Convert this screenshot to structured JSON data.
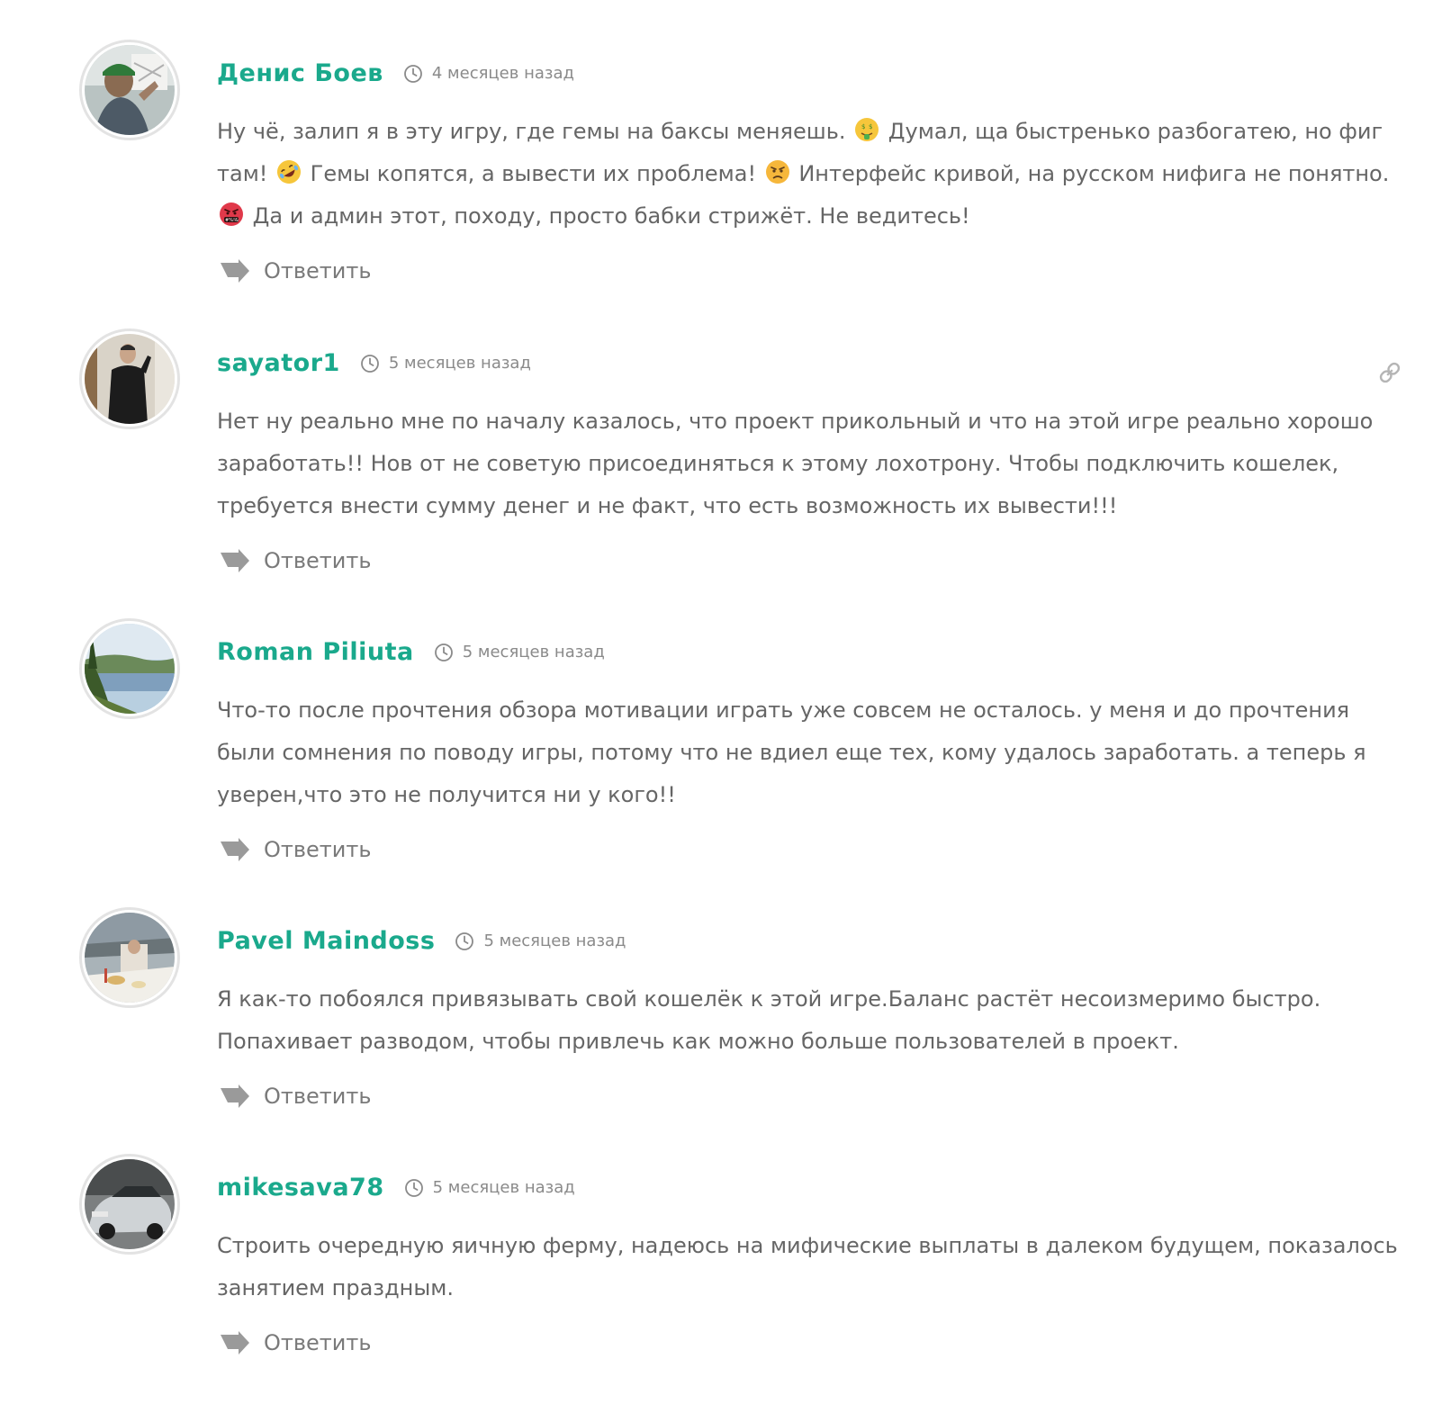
{
  "colors": {
    "accent": "#1aa98c",
    "text": "#666666",
    "meta": "#8a8a8a"
  },
  "comments": [
    {
      "author": "Денис Боев",
      "time": "4 месяцев назад",
      "text_parts": [
        "Ну чё, залип я в эту игру, где гемы на баксы меняешь. ",
        " Думал, ща быстренько разбогатею, но фиг там! ",
        " Гемы копятся, а вывести их проблема! ",
        " Интерфейс кривой, на русском нифига не понятно. ",
        " Да и админ этот, походу, просто бабки стрижёт. Не ведитесь!"
      ],
      "emojis": [
        "money-mouth-face-emoji",
        "rolling-on-floor-laughing-emoji",
        "angry-face-emoji",
        "face-with-symbols-on-mouth-emoji"
      ],
      "reply_label": "Ответить",
      "avatar_icon": "user-avatar"
    },
    {
      "author": "sayator1",
      "time": "5 месяцев назад",
      "text": "Нет ну реально мне по началу казалось, что проект прикольный и что на этой игре реально хорошо заработать!! Нов от не советую присоединяться к этому лохотрону. Чтобы подключить кошелек, требуется внести сумму денег и не факт, что есть возможность их вывести!!!",
      "reply_label": "Ответить",
      "avatar_icon": "user-avatar",
      "permalink_icon": "link-icon"
    },
    {
      "author": "Roman Piliuta",
      "time": "5 месяцев назад",
      "text": "Что-то после прочтения обзора мотивации играть уже совсем не осталось. у меня и до прочтения были сомнения по поводу игры, потому что не вдиел еще тех, кому удалось заработать. а теперь я уверен,что это не получится ни у кого!!",
      "reply_label": "Ответить",
      "avatar_icon": "user-avatar"
    },
    {
      "author": "Pavel Maindoss",
      "time": "5 месяцев назад",
      "text": "Я как-то побоялся привязывать свой кошелёк к этой игре.Баланс растёт несоизмеримо быстро. Попахивает разводом, чтобы привлечь как можно больше пользователей в проект.",
      "reply_label": "Ответить",
      "avatar_icon": "user-avatar"
    },
    {
      "author": "mikesava78",
      "time": "5 месяцев назад",
      "text": "Строить очередную яичную ферму, надеюсь на мифические выплаты в далеком будущем, показалось занятием праздным.",
      "reply_label": "Ответить",
      "avatar_icon": "user-avatar"
    }
  ]
}
